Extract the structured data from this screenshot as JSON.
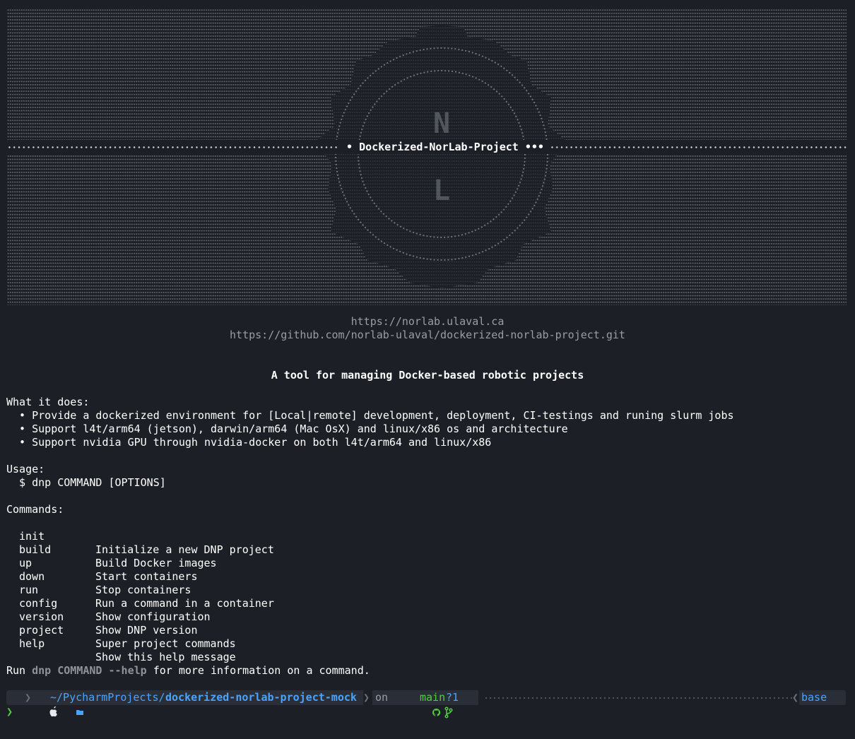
{
  "banner": {
    "title": "Dockerized-NorLab-Project",
    "title_prefix": "•",
    "title_suffix": "•••"
  },
  "links": {
    "site": "https://norlab.ulaval.ca",
    "repo": "https://github.com/norlab-ulaval/dockerized-norlab-project.git"
  },
  "tagline": "A tool for managing Docker-based robotic projects",
  "what_it_does": {
    "heading": "What it does:",
    "items": [
      "  • Provide a dockerized environment for [Local|remote] development, deployment, CI-testings and runing slurm jobs",
      "  • Support l4t/arm64 (jetson), darwin/arm64 (Mac OsX) and linux/x86 os and architecture",
      "  • Support nvidia GPU through nvidia-docker on both l4t/arm64 and linux/x86"
    ]
  },
  "usage": {
    "heading": "Usage:",
    "line": "  $ dnp COMMAND [OPTIONS]"
  },
  "commands": {
    "heading": "Commands:",
    "items": [
      {
        "name": "init",
        "desc": "Initialize a new DNP project"
      },
      {
        "name": "build",
        "desc": "Build Docker images"
      },
      {
        "name": "up",
        "desc": "Start containers"
      },
      {
        "name": "down",
        "desc": "Stop containers"
      },
      {
        "name": "run",
        "desc": "Run a command in a container"
      },
      {
        "name": "config",
        "desc": "Show configuration"
      },
      {
        "name": "version",
        "desc": "Show DNP version"
      },
      {
        "name": "project",
        "desc": "Super project commands"
      },
      {
        "name": "help",
        "desc": "Show this help message"
      }
    ]
  },
  "footer": {
    "run": "Run",
    "cmd": "dnp COMMAND --help",
    "rest": "for more information on a command."
  },
  "statusbar": {
    "os_icon": "apple-icon",
    "folder_icon": "folder-icon",
    "path_prefix": "~/PycharmProjects/",
    "path_dir": "dockerized-norlab-project-mock",
    "on": "on",
    "git_icon": "github-icon",
    "branch_icon": "git-branch-icon",
    "branch": "main",
    "git_status": "?1",
    "env": "base",
    "env_icon": "python-icon"
  },
  "prompt_char": "❯",
  "colors": {
    "background": "#1c2026",
    "path_blue": "#4aa3ff",
    "git_green": "#4fd13d",
    "muted": "#9a9ea3"
  }
}
